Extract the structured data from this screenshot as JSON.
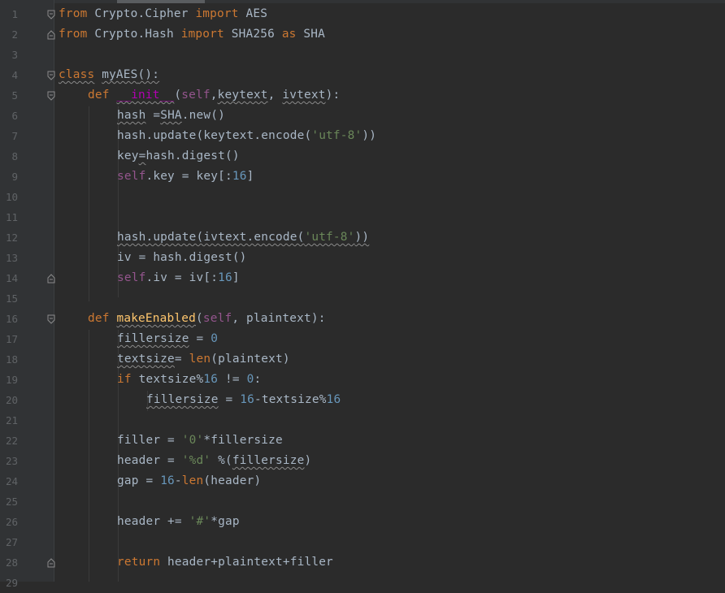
{
  "editor": {
    "line_numbers": [
      "1",
      "2",
      "3",
      "4",
      "5",
      "6",
      "7",
      "8",
      "9",
      "10",
      "11",
      "12",
      "13",
      "14",
      "15",
      "16",
      "17",
      "18",
      "19",
      "20",
      "21",
      "22",
      "23",
      "24",
      "25",
      "26",
      "27",
      "28",
      "29"
    ],
    "lines": {
      "l1": {
        "a": "from",
        "b": " Crypto.Cipher ",
        "c": "import",
        "d": " AES"
      },
      "l2": {
        "a": "from",
        "b": " Crypto.Hash ",
        "c": "import",
        "d": " SHA256 ",
        "e": "as",
        "f": " SHA"
      },
      "l4": {
        "a": "class",
        "b": " ",
        "c": "myAES",
        "d": "():"
      },
      "l5": {
        "a": "def",
        "b": " ",
        "c": "__init__",
        "d": "(",
        "e": "self",
        "f": ",",
        "g": "keytext",
        ",": ", ",
        "h": "ivtext",
        "i": "):"
      },
      "l6": {
        "a": "hash",
        "b": " =",
        "c": "SHA",
        "d": ".new()"
      },
      "l7": {
        "a": "hash.update(keytext.encode(",
        "b": "'utf-8'",
        "c": "))"
      },
      "l8": {
        "a": "key",
        "b": "=",
        "c": "hash.digest()"
      },
      "l9": {
        "a": "self",
        "b": ".key = key[:",
        "c": "16",
        "d": "]"
      },
      "l12": {
        "a": "hash.update(ivtext.encode(",
        "b": "'utf-8'",
        "c": "))"
      },
      "l13": {
        "a": "iv = hash.digest()"
      },
      "l14": {
        "a": "self",
        "b": ".iv = iv[:",
        "c": "16",
        "d": "]"
      },
      "l16": {
        "a": "def",
        "b": " ",
        "c": "makeEnabled",
        "d": "(",
        "e": "self",
        ",": ", plaintext):"
      },
      "l17": {
        "a": "fillersize",
        "b": " = ",
        "c": "0"
      },
      "l18": {
        "a": "textsize",
        "b": "= ",
        "c": "len",
        "d": "(plaintext)"
      },
      "l19": {
        "a": "if",
        "b": " textsize%",
        "c": "16",
        "d": " != ",
        "e": "0",
        "f": ":"
      },
      "l20": {
        "a": "fillersize",
        "b": " = ",
        "c": "16",
        "d": "-textsize%",
        "e": "16"
      },
      "l22": {
        "a": "filler = ",
        "b": "'0'",
        "c": "*fillersize"
      },
      "l23": {
        "a": "header = ",
        "b": "'%d'",
        "c": " %(",
        "d": "fillersize",
        "e": ")"
      },
      "l24": {
        "a": "gap = ",
        "b": "16",
        "c": "-",
        "d": "len",
        "e": "(header)"
      },
      "l26": {
        "a": "header += ",
        "b": "'#'",
        "c": "*gap"
      },
      "l28": {
        "a": "return",
        "b": " header+plaintext+filler"
      }
    }
  },
  "colors": {
    "background": "#2b2b2b",
    "gutter": "#313335",
    "keyword": "#cc7832",
    "string": "#6a8759",
    "number": "#6897bb",
    "self": "#94558d",
    "function": "#ffc66d",
    "text": "#a9b7c6"
  }
}
